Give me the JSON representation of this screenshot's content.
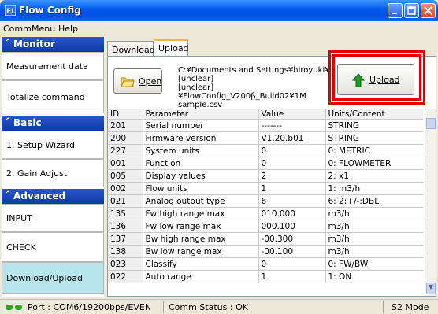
{
  "window": {
    "title": "Flow Config"
  },
  "menu": {
    "items": [
      "Comm",
      "Menu",
      "Help"
    ]
  },
  "sidebar": {
    "sections": [
      {
        "title": "Monitor",
        "items": [
          "Measurement data",
          "Totalize command"
        ]
      },
      {
        "title": "Basic",
        "items": [
          "1. Setup Wizard",
          "2. Gain Adjust"
        ]
      },
      {
        "title": "Advanced",
        "items": [
          "INPUT",
          "CHECK",
          "Download/Upload"
        ]
      }
    ],
    "active_item": "Download/Upload"
  },
  "tabs": [
    "Download",
    "Upload"
  ],
  "active_tab": "Upload",
  "upload_panel": {
    "open_button_label": "Open",
    "file_path_lines": [
      "C:¥Documents and Settings¥hiroyuki¥[unclear]",
      "[unclear]¥FlowConfig_V200β_Build02¥1M",
      "sample.csv"
    ],
    "upload_button_label": "Upload"
  },
  "table": {
    "columns": [
      "ID",
      "Parameter",
      "Value",
      "Units/Content"
    ],
    "rows": [
      [
        "201",
        "Serial number",
        "-------",
        "STRING"
      ],
      [
        "200",
        "Firmware version",
        "V1.20.b01",
        "STRING"
      ],
      [
        "227",
        "System units",
        "0",
        "0: METRIC"
      ],
      [
        "001",
        "Function",
        "0",
        "0: FLOWMETER"
      ],
      [
        "005",
        "Display values",
        "2",
        "2: x1"
      ],
      [
        "002",
        "Flow units",
        "1",
        "1: m3/h"
      ],
      [
        "021",
        "Analog output type",
        "6",
        "6: 2:+/-:DBL"
      ],
      [
        "135",
        "Fw high range max",
        "010.000",
        "m3/h"
      ],
      [
        "136",
        "Fw low range max",
        "000.100",
        "m3/h"
      ],
      [
        "137",
        "Bw high range max",
        "-00.300",
        "m3/h"
      ],
      [
        "138",
        "Bw low range max",
        "-00.100",
        "m3/h"
      ],
      [
        "023",
        "Classify",
        "0",
        "0: FW/BW"
      ],
      [
        "022",
        "Auto range",
        "1",
        "1: ON"
      ]
    ]
  },
  "status": {
    "port": "Port : COM6/19200bps/EVEN",
    "comm_status": "Comm Status : OK",
    "mode": "S2 Mode"
  },
  "colors": {
    "accent": "#0058EE",
    "highlight": "#E00000",
    "active_nav": "#B8E4EC",
    "led": "#1DAA2A"
  }
}
